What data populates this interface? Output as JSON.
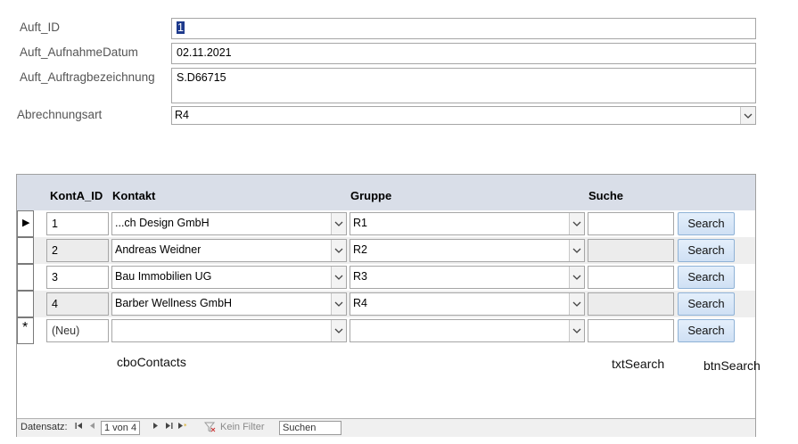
{
  "form": {
    "auft_id": {
      "label": "Auft_ID",
      "value": "1"
    },
    "aufnahme_datum": {
      "label": "Auft_AufnahmeDatum",
      "value": "02.11.2021"
    },
    "auftragbezeichnung": {
      "label": "Auft_Auftragbezeichnung",
      "value": "S.D66715"
    },
    "abrechnungsart": {
      "label": "Abrechnungsart",
      "value": "R4"
    }
  },
  "subform": {
    "columns": {
      "id": "KontA_ID",
      "kontakt": "Kontakt",
      "gruppe": "Gruppe",
      "suche": "Suche"
    },
    "rows": [
      {
        "id": "1",
        "kontakt": "...ch Design GmbH",
        "gruppe": "R1",
        "button": "Search"
      },
      {
        "id": "2",
        "kontakt": "Andreas Weidner",
        "gruppe": "R2",
        "button": "Search"
      },
      {
        "id": "3",
        "kontakt": "Bau Immobilien UG",
        "gruppe": "R3",
        "button": "Search"
      },
      {
        "id": "4",
        "kontakt": "Barber Wellness GmbH",
        "gruppe": "R4",
        "button": "Search"
      }
    ],
    "new_row": {
      "marker": "*",
      "id": "(Neu)",
      "button": "Search"
    },
    "current_marker": "▶"
  },
  "navigation": {
    "label": "Datensatz:",
    "position": "1 von 4",
    "filter": "Kein Filter",
    "search": "Suchen"
  },
  "annotations": {
    "contacts": "cboContacts",
    "txt_search": "txtSearch",
    "btn_search": "btnSearch"
  },
  "icons": {
    "dropdown": "chevron-down-icon",
    "filter": "funnel-icon",
    "first": "first-record-icon",
    "prev": "previous-record-icon",
    "next": "next-record-icon",
    "last": "last-record-icon",
    "new": "new-record-icon"
  }
}
